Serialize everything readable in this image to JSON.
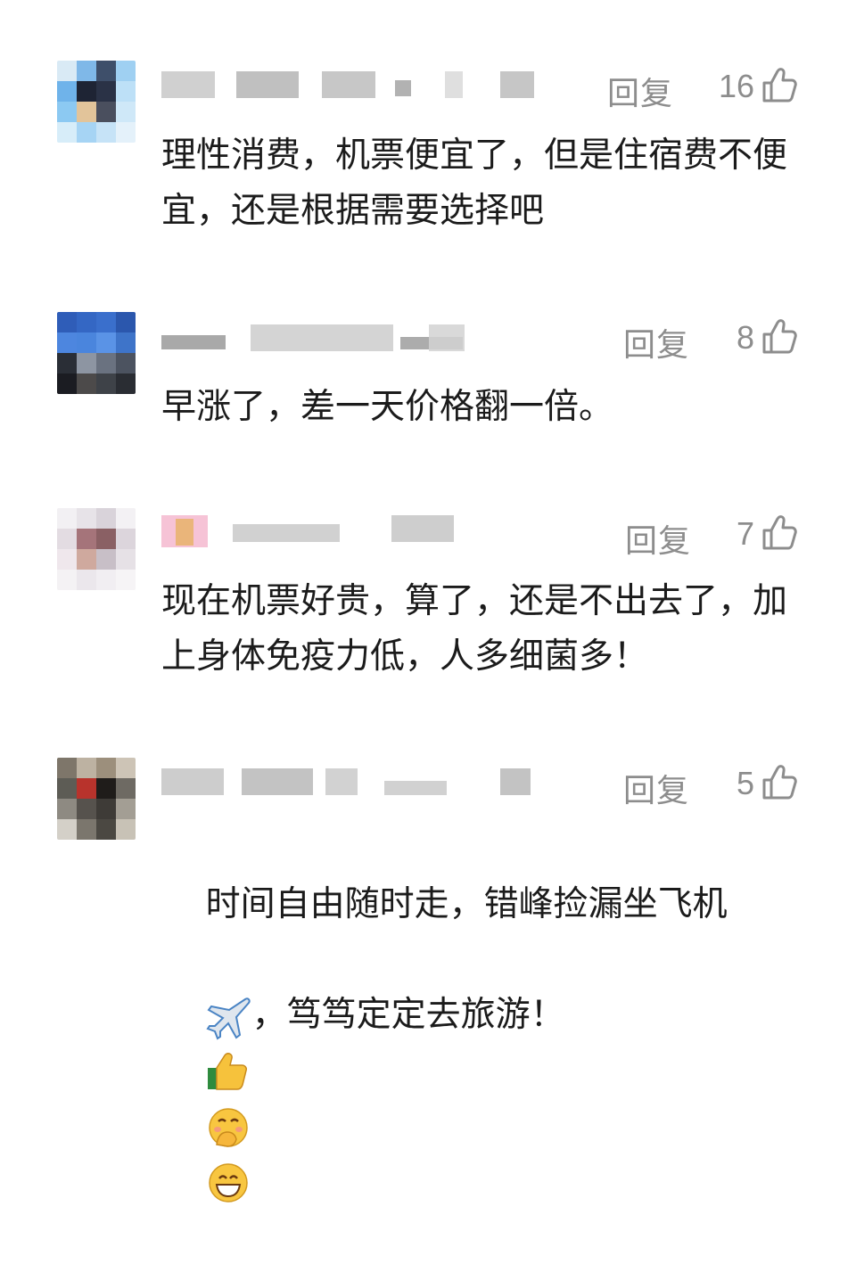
{
  "comments": [
    {
      "reply_label": "回复",
      "likes": "16",
      "text": "理性消费，机票便宜了，但是住宿费不便宜，还是根据需要选择吧",
      "avatar_colors": [
        "#d9eaf5",
        "#7fb8e8",
        "#3e4f6a",
        "#9fd0f2",
        "#6fb3ea",
        "#1e2434",
        "#2a3246",
        "#bde0f7",
        "#8cc9f2",
        "#e2c49a",
        "#4a4f5e",
        "#cfe8f8",
        "#d7edf9",
        "#a6d4f4",
        "#c6e3f7",
        "#e4f1fa"
      ]
    },
    {
      "reply_label": "回复",
      "likes": "8",
      "text": "早涨了，差一天价格翻一倍。",
      "avatar_colors": [
        "#2f5db8",
        "#3467c4",
        "#3a6fcc",
        "#2b57ad",
        "#4d86df",
        "#4a85dd",
        "#5a93e6",
        "#3e74c9",
        "#2a2e36",
        "#8d95a2",
        "#6a7280",
        "#4c5360",
        "#1b1c22",
        "#4c4a4a",
        "#3e4248",
        "#2a2d33"
      ]
    },
    {
      "reply_label": "回复",
      "likes": "7",
      "text": "现在机票好贵，算了，还是不出去了，加上身体免疫力低，人多细菌多！",
      "avatar_colors": [
        "#f2f0f3",
        "#e7e3e8",
        "#d9d3da",
        "#f3f1f4",
        "#e3dce2",
        "#a5747a",
        "#8a6064",
        "#dcd5dc",
        "#efe7ec",
        "#cfa99e",
        "#c8bfc7",
        "#e6e1e6",
        "#f4f2f4",
        "#ebe7ec",
        "#f1eef2",
        "#f6f4f6"
      ]
    },
    {
      "reply_label": "回复",
      "likes": "5",
      "text": "时间自由随时走，错峰捡漏坐飞机",
      "text2": "，笃笃定定去旅游！",
      "avatar_colors": [
        "#7e766a",
        "#bdb2a2",
        "#9c8f7c",
        "#cdc4b6",
        "#5d5c55",
        "#b8332c",
        "#1f1c1a",
        "#6e6a63",
        "#8e8a82",
        "#56524d",
        "#3e3b37",
        "#a39e94",
        "#d4d0c8",
        "#7b766d",
        "#4b4842",
        "#c8c2b6"
      ]
    }
  ],
  "icons": {
    "thumb": "thumbs-up-outline-icon",
    "airplane": "airplane-emoji",
    "thumbs_emoji": "thumbs-up-emoji",
    "shy": "face-with-hand-over-mouth-emoji",
    "grin": "grinning-face-emoji"
  },
  "colors": {
    "meta_text": "#8d8d8d",
    "body_text": "#1b1b1b"
  }
}
